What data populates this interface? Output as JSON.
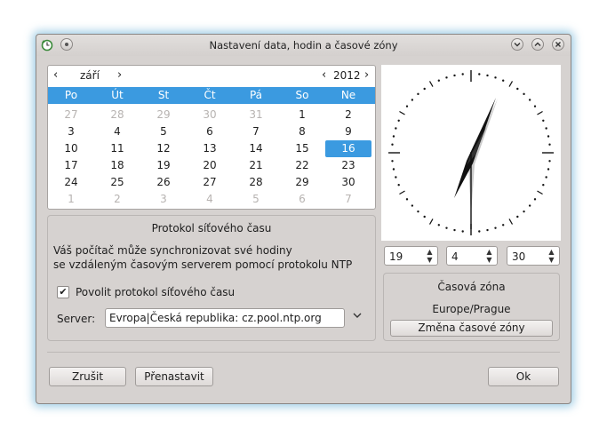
{
  "window": {
    "title": "Nastavení data, hodin a časové zóny"
  },
  "icons": {
    "app": "clock-refresh-icon",
    "menu": "window-menu-icon",
    "minimize": "minimize-icon",
    "maximize": "maximize-icon",
    "close": "close-icon"
  },
  "calendar": {
    "month": "září",
    "year": "2012",
    "prev_month": "‹",
    "next_month": "›",
    "prev_year": "‹",
    "next_year": "›",
    "weekdays": [
      "Po",
      "Út",
      "St",
      "Čt",
      "Pá",
      "So",
      "Ne"
    ],
    "selected_day": "16",
    "weeks": [
      [
        {
          "d": "27",
          "dim": true
        },
        {
          "d": "28",
          "dim": true
        },
        {
          "d": "29",
          "dim": true
        },
        {
          "d": "30",
          "dim": true
        },
        {
          "d": "31",
          "dim": true
        },
        {
          "d": "1"
        },
        {
          "d": "2"
        }
      ],
      [
        {
          "d": "3"
        },
        {
          "d": "4"
        },
        {
          "d": "5"
        },
        {
          "d": "6"
        },
        {
          "d": "7"
        },
        {
          "d": "8"
        },
        {
          "d": "9"
        }
      ],
      [
        {
          "d": "10"
        },
        {
          "d": "11"
        },
        {
          "d": "12"
        },
        {
          "d": "13"
        },
        {
          "d": "14"
        },
        {
          "d": "15"
        },
        {
          "d": "16",
          "sel": true
        }
      ],
      [
        {
          "d": "17"
        },
        {
          "d": "18"
        },
        {
          "d": "19"
        },
        {
          "d": "20"
        },
        {
          "d": "21"
        },
        {
          "d": "22"
        },
        {
          "d": "23"
        }
      ],
      [
        {
          "d": "24"
        },
        {
          "d": "25"
        },
        {
          "d": "26"
        },
        {
          "d": "27"
        },
        {
          "d": "28"
        },
        {
          "d": "29"
        },
        {
          "d": "30"
        }
      ],
      [
        {
          "d": "1",
          "dim": true
        },
        {
          "d": "2",
          "dim": true
        },
        {
          "d": "3",
          "dim": true
        },
        {
          "d": "4",
          "dim": true
        },
        {
          "d": "5",
          "dim": true
        },
        {
          "d": "6",
          "dim": true
        },
        {
          "d": "7",
          "dim": true
        }
      ]
    ]
  },
  "time": {
    "hour": "19",
    "minute": "4",
    "second": "30"
  },
  "ntp": {
    "title": "Protokol síťového času",
    "description_line1": "Váš počítač může synchronizovat své hodiny",
    "description_line2": "se vzdáleným časovým serverem pomocí protokolu NTP",
    "enable_label": "Povolit protokol síťového času",
    "enabled": true,
    "server_label": "Server:",
    "server_value": "Evropa|Česká republika: cz.pool.ntp.org"
  },
  "timezone": {
    "title": "Časová zóna",
    "value": "Europe/Prague",
    "change_button": "Změna časové zóny"
  },
  "buttons": {
    "cancel": "Zrušit",
    "reset": "Přenastavit",
    "ok": "Ok"
  },
  "colors": {
    "accent": "#3b9ae0",
    "window_bg": "#d6d2d0",
    "glow": "#82bedc"
  }
}
